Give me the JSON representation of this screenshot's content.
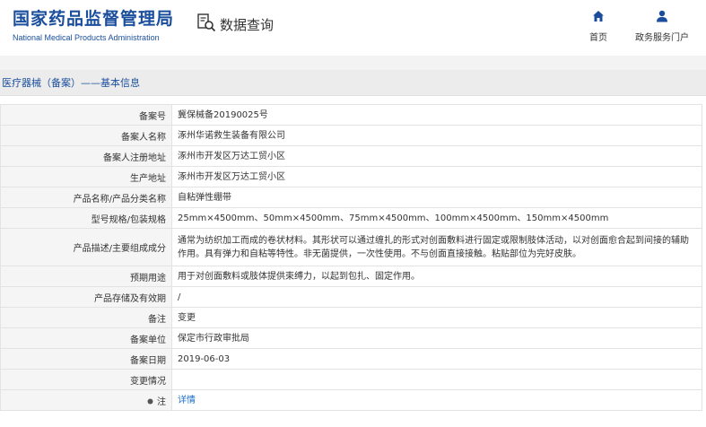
{
  "header": {
    "logo_cn": "国家药品监督管理局",
    "logo_en": "National Medical Products Administration",
    "search_title": "数据查询",
    "nav": [
      {
        "label": "首页",
        "icon": "home-icon"
      },
      {
        "label": "政务服务门户",
        "icon": "user-icon"
      }
    ]
  },
  "breadcrumb": "医疗器械（备案）——基本信息",
  "colors": {
    "brand": "#1a4e9c",
    "link": "#1a6ec7",
    "label_bg": "#f5f5f5"
  },
  "rows": [
    {
      "key": "备案号",
      "value": "冀保械备20190025号"
    },
    {
      "key": "备案人名称",
      "value": "涿州华诺救生装备有限公司"
    },
    {
      "key": "备案人注册地址",
      "value": "涿州市开发区万达工贸小区"
    },
    {
      "key": "生产地址",
      "value": "涿州市开发区万达工贸小区"
    },
    {
      "key": "产品名称/产品分类名称",
      "value": "自粘弹性绷带"
    },
    {
      "key": "型号规格/包装规格",
      "value": "25mm×4500mm、50mm×4500mm、75mm×4500mm、100mm×4500mm、150mm×4500mm"
    },
    {
      "key": "产品描述/主要组成成分",
      "value": "通常为纺织加工而成的卷状材料。其形状可以通过缠扎的形式对创面敷料进行固定或限制肢体活动，以对创面愈合起到间接的辅助作用。具有弹力和自粘等特性。非无菌提供，一次性使用。不与创面直接接触。粘贴部位为完好皮肤。"
    },
    {
      "key": "预期用途",
      "value": "用于对创面敷料或肢体提供束缚力，以起到包扎、固定作用。"
    },
    {
      "key": "产品存储及有效期",
      "value": "/"
    },
    {
      "key": "备注",
      "value": "变更"
    },
    {
      "key": "备案单位",
      "value": "保定市行政审批局"
    },
    {
      "key": "备案日期",
      "value": "2019-06-03"
    },
    {
      "key": "变更情况",
      "value": ""
    },
    {
      "key": "注",
      "value": "详情",
      "icon": "bullet-icon"
    }
  ]
}
